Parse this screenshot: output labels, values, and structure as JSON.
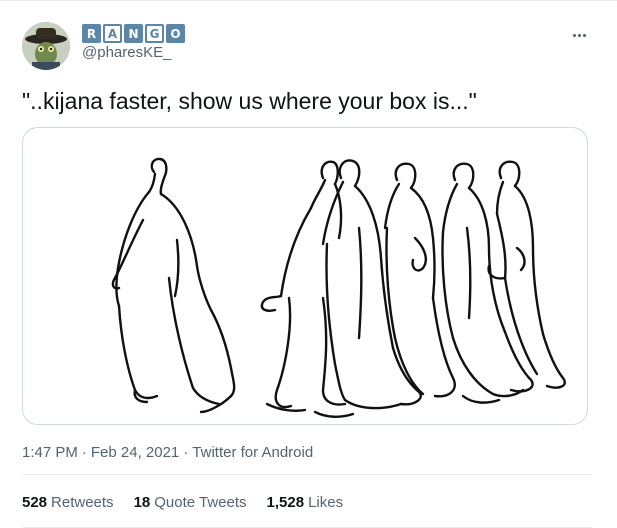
{
  "author": {
    "display_name_letters": [
      "R",
      "A",
      "N",
      "G",
      "O"
    ],
    "handle": "@pharesKE_"
  },
  "menu": {
    "more_icon": "more-horizontal-icon"
  },
  "tweet": {
    "text": "\"..kijana faster, show us where your box is...\"",
    "media_alt": "line drawing of walking figures in robes"
  },
  "meta": {
    "time": "1:47 PM",
    "separator": "·",
    "date": "Feb 24, 2021",
    "source": "Twitter for Android"
  },
  "stats": {
    "retweets_count": "528",
    "retweets_label": "Retweets",
    "quote_count": "18",
    "quote_label": "Quote Tweets",
    "likes_count": "1,528",
    "likes_label": "Likes"
  },
  "colors": {
    "text": "#0f1419",
    "secondary": "#536471",
    "border": "#cfd9de",
    "name_box": "#5b86a8"
  }
}
